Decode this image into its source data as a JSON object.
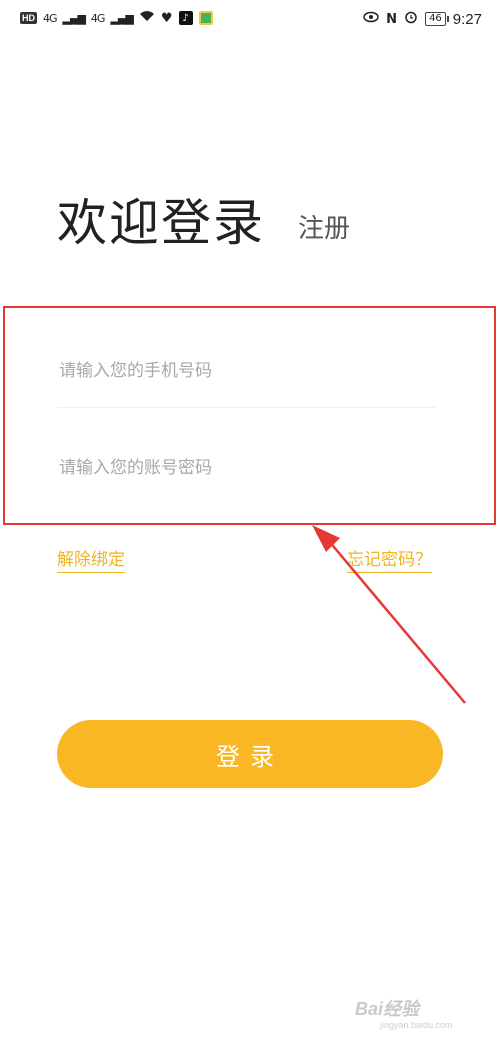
{
  "status_bar": {
    "left_hd": "HD",
    "network_a": "4G",
    "network_b": "4G",
    "battery": "46",
    "time": "9:27"
  },
  "login": {
    "title": "欢迎登录",
    "register_link": "注册",
    "phone_placeholder": "请输入您的手机号码",
    "password_placeholder": "请输入您的账号密码",
    "unbind_link": "解除绑定",
    "forgot_link": "忘记密码？",
    "login_button": "登录"
  },
  "watermark": {
    "brand": "Bai经验",
    "url": "jingyan.baidu.com"
  },
  "colors": {
    "accent": "#f8b723",
    "link": "#f0b323",
    "annotation": "#e53935"
  }
}
